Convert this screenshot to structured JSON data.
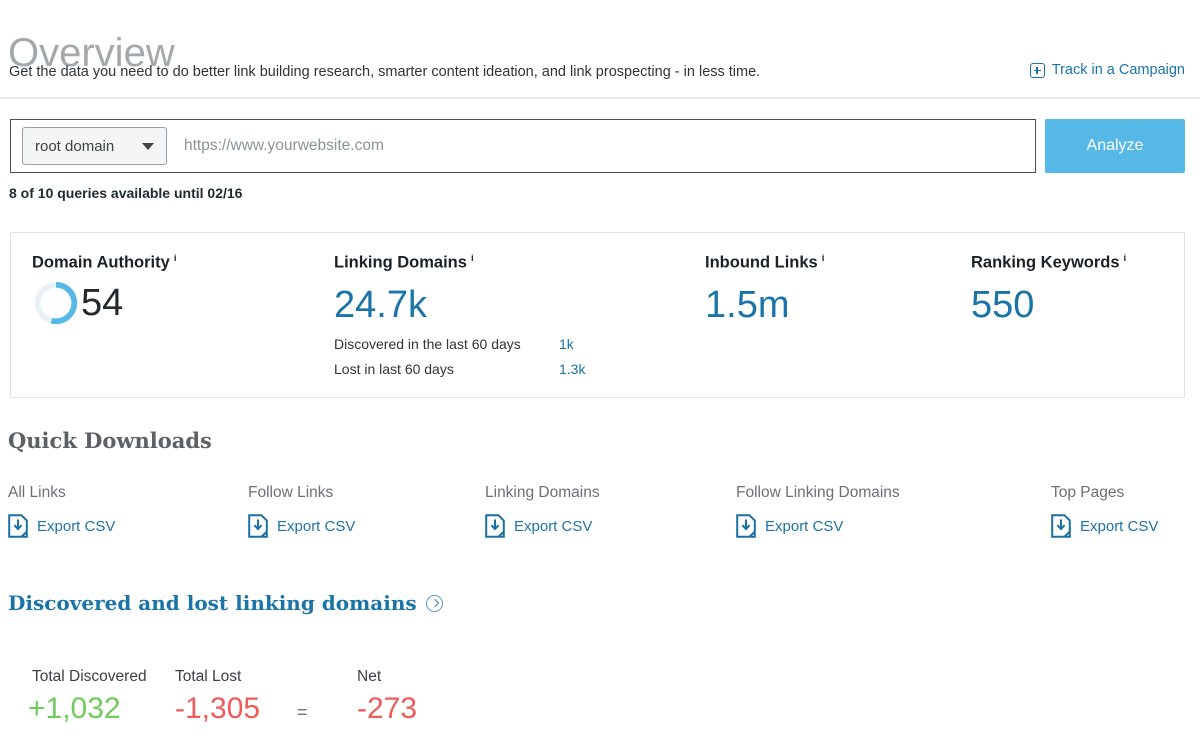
{
  "header": {
    "title": "Overview",
    "subtitle": "Get the data you need to do better link building research, smarter content ideation, and link prospecting - in less time.",
    "track_link": "Track in a Campaign",
    "track_icon": "plus-box-icon"
  },
  "search": {
    "type_selected": "root domain",
    "caret_icon": "chevron-down-icon",
    "placeholder": "https://www.yourwebsite.com",
    "value": "",
    "analyze_label": "Analyze",
    "queries_note": "8 of 10 queries available until 02/16"
  },
  "metrics": {
    "domain_authority": {
      "title": "Domain Authority",
      "info_icon": "i",
      "value": "54",
      "gauge_percent": 54
    },
    "linking_domains": {
      "title": "Linking Domains",
      "info_icon": "i",
      "value": "24.7k",
      "sub": [
        {
          "label": "Discovered in the last 60 days",
          "value": "1k"
        },
        {
          "label": "Lost in last 60 days",
          "value": "1.3k"
        }
      ]
    },
    "inbound_links": {
      "title": "Inbound Links",
      "info_icon": "i",
      "value": "1.5m"
    },
    "ranking_keywords": {
      "title": "Ranking Keywords",
      "info_icon": "i",
      "value": "550"
    }
  },
  "quick_downloads": {
    "title": "Quick Downloads",
    "columns": [
      {
        "label": "All Links",
        "action": "Export CSV",
        "icon": "document-download-icon"
      },
      {
        "label": "Follow Links",
        "action": "Export CSV",
        "icon": "document-download-icon"
      },
      {
        "label": "Linking Domains",
        "action": "Export CSV",
        "icon": "document-download-icon"
      },
      {
        "label": "Follow Linking Domains",
        "action": "Export CSV",
        "icon": "document-download-icon"
      },
      {
        "label": "Top Pages",
        "action": "Export CSV",
        "icon": "document-download-icon"
      }
    ]
  },
  "discovered_lost": {
    "title": "Discovered and lost linking domains",
    "chevron_icon": "chevron-right-circle-icon",
    "totals": {
      "discovered_label": "Total Discovered",
      "discovered_value": "+1,032",
      "lost_label": "Total Lost",
      "lost_value": "-1,305",
      "equals": "=",
      "net_label": "Net",
      "net_value": "-273"
    }
  },
  "colors": {
    "accent_blue": "#1b74a8",
    "button_blue": "#55b8e6",
    "positive_green": "#6fcc5a",
    "negative_red": "#ef5a5a",
    "title_gray": "#a3a8ad"
  }
}
